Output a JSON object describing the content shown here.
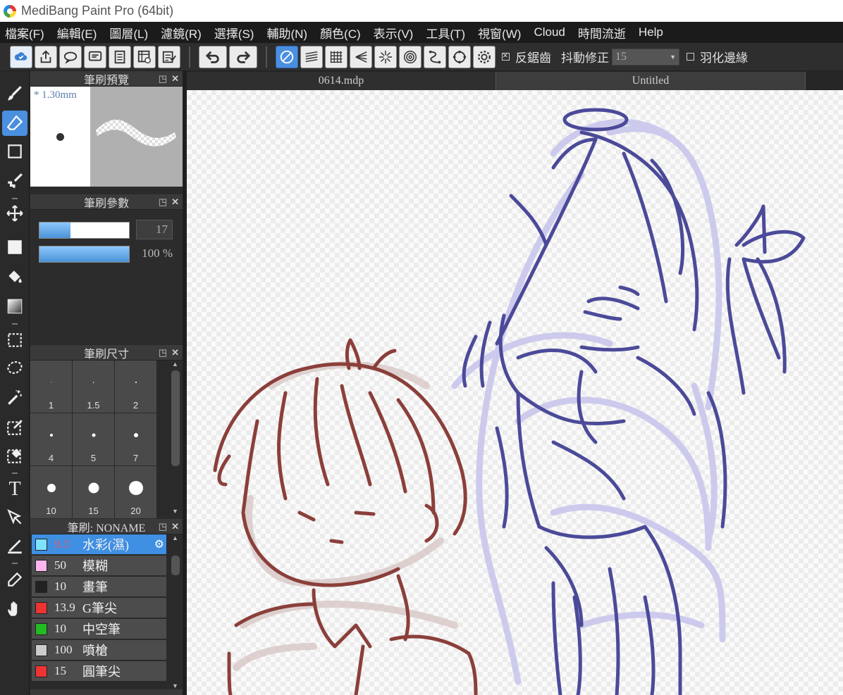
{
  "titlebar": {
    "title": "MediBang Paint Pro (64bit)"
  },
  "menu": [
    "檔案(F)",
    "編輯(E)",
    "圖層(L)",
    "濾鏡(R)",
    "選擇(S)",
    "輔助(N)",
    "顏色(C)",
    "表示(V)",
    "工具(T)",
    "視窗(W)",
    "Cloud",
    "時間流逝",
    "Help"
  ],
  "toolbar": {
    "antialias_label": "反鋸齒",
    "antialias_checked": true,
    "stabilizer_label": "抖動修正",
    "stabilizer_value": "15",
    "feather_label": "羽化邊緣",
    "feather_checked": false,
    "accent_color": "#4a8fe0",
    "left_icons": [
      "cloud-check-icon",
      "share-icon",
      "comment-icon",
      "chat-icon",
      "document-icon",
      "timelapse-icon",
      "checklist-icon"
    ],
    "edit_icons": [
      "undo-icon",
      "redo-icon"
    ],
    "snap_icons": [
      "snap-off-icon",
      "parallel-snap-icon",
      "grid-snap-icon",
      "perspective-snap-icon",
      "radial-snap-icon",
      "concentric-snap-icon",
      "curve-snap-icon",
      "ellipse-snap-icon",
      "snap-settings-icon"
    ]
  },
  "tools": [
    "brush-icon",
    "eraser-icon",
    "dot-icon",
    "brush-move-icon",
    "move-icon",
    "fill-rect-icon",
    "bucket-icon",
    "gradient-icon",
    "select-rect-icon",
    "lasso-icon",
    "magic-wand-icon",
    "select-pen-icon",
    "select-eraser-icon",
    "text-icon",
    "operation-icon",
    "divide-icon",
    "eyedropper-icon",
    "hand-icon"
  ],
  "panels": {
    "brush_preview": {
      "title": "筆刷預覽",
      "size_text": "* 1.30mm"
    },
    "brush_params": {
      "title": "筆刷參數",
      "width_value": "17",
      "opacity_value": "100 %",
      "width_fraction": 0.35,
      "opacity_fraction": 1.0
    },
    "brush_size": {
      "title": "筆刷尺寸",
      "sizes": [
        {
          "label": "1",
          "d": 1
        },
        {
          "label": "1.5",
          "d": 1.5
        },
        {
          "label": "2",
          "d": 2
        },
        {
          "label": "4",
          "d": 4
        },
        {
          "label": "5",
          "d": 5
        },
        {
          "label": "7",
          "d": 6
        },
        {
          "label": "10",
          "d": 12
        },
        {
          "label": "15",
          "d": 15
        },
        {
          "label": "20",
          "d": 20
        }
      ]
    },
    "brush_list": {
      "title": "筆刷: NONAME",
      "items": [
        {
          "size": "9.3",
          "name": "水彩(濕)",
          "color": "#7fe3ff",
          "selected": true
        },
        {
          "size": "50",
          "name": "模糊",
          "color": "#ffb6f0",
          "selected": false
        },
        {
          "size": "10",
          "name": "畫筆",
          "color": "#222222",
          "selected": false
        },
        {
          "size": "13.9",
          "name": "G筆尖",
          "color": "#ee3333",
          "selected": false
        },
        {
          "size": "10",
          "name": "中空筆",
          "color": "#22bb22",
          "selected": false
        },
        {
          "size": "100",
          "name": "噴槍",
          "color": "#cccccc",
          "selected": false
        },
        {
          "size": "15",
          "name": "圓筆尖",
          "color": "#ee3333",
          "selected": false
        }
      ]
    }
  },
  "tabs": [
    {
      "label": "0614.mdp",
      "active": false
    },
    {
      "label": "Untitled",
      "active": true
    }
  ],
  "canvas": {
    "line_colors": [
      "#8b3f3a",
      "#4b4a99",
      "#c9c6ec",
      "#d8c8c6"
    ]
  }
}
